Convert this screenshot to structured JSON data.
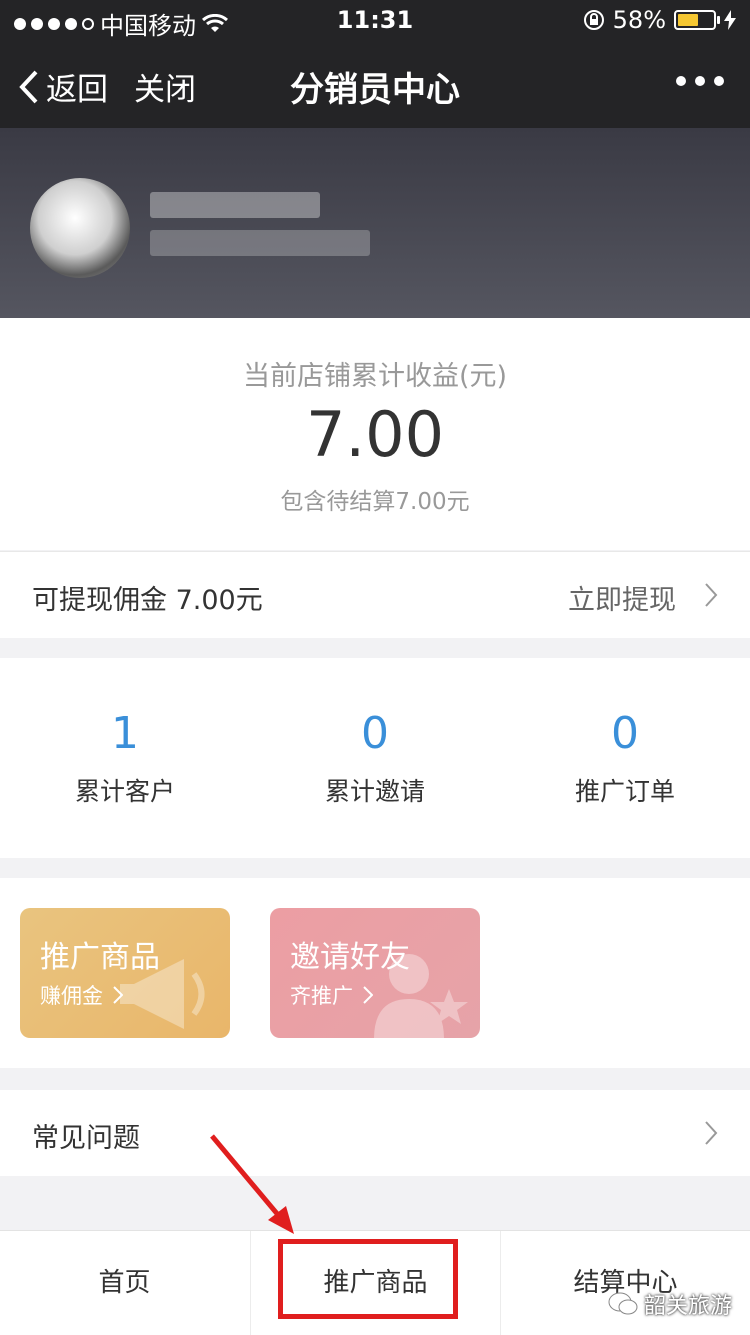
{
  "status_bar": {
    "carrier": "中国移动",
    "time": "11:31",
    "battery": "58%",
    "battery_level": 0.58
  },
  "nav": {
    "back_label": "返回",
    "close_label": "关闭",
    "title": "分销员中心"
  },
  "earnings": {
    "label": "当前店铺累计收益(元)",
    "value": "7.00",
    "note": "包含待结算7.00元"
  },
  "withdraw": {
    "label": "可提现佣金 7.00元",
    "action": "立即提现"
  },
  "stats": [
    {
      "value": "1",
      "label": "累计客户"
    },
    {
      "value": "0",
      "label": "累计邀请"
    },
    {
      "value": "0",
      "label": "推广订单"
    }
  ],
  "cards": [
    {
      "title": "推广商品",
      "subtitle": "赚佣金"
    },
    {
      "title": "邀请好友",
      "subtitle": "齐推广"
    }
  ],
  "faq": {
    "label": "常见问题"
  },
  "tabbar": {
    "tabs": [
      "首页",
      "推广商品",
      "结算中心"
    ]
  },
  "watermark": "韶关旅游",
  "colors": {
    "accent": "#3a8fd9",
    "highlight": "#e01e1e",
    "promote_card": "#e9c47f",
    "invite_card": "#ec9ea3",
    "header_dark": "#242426"
  }
}
